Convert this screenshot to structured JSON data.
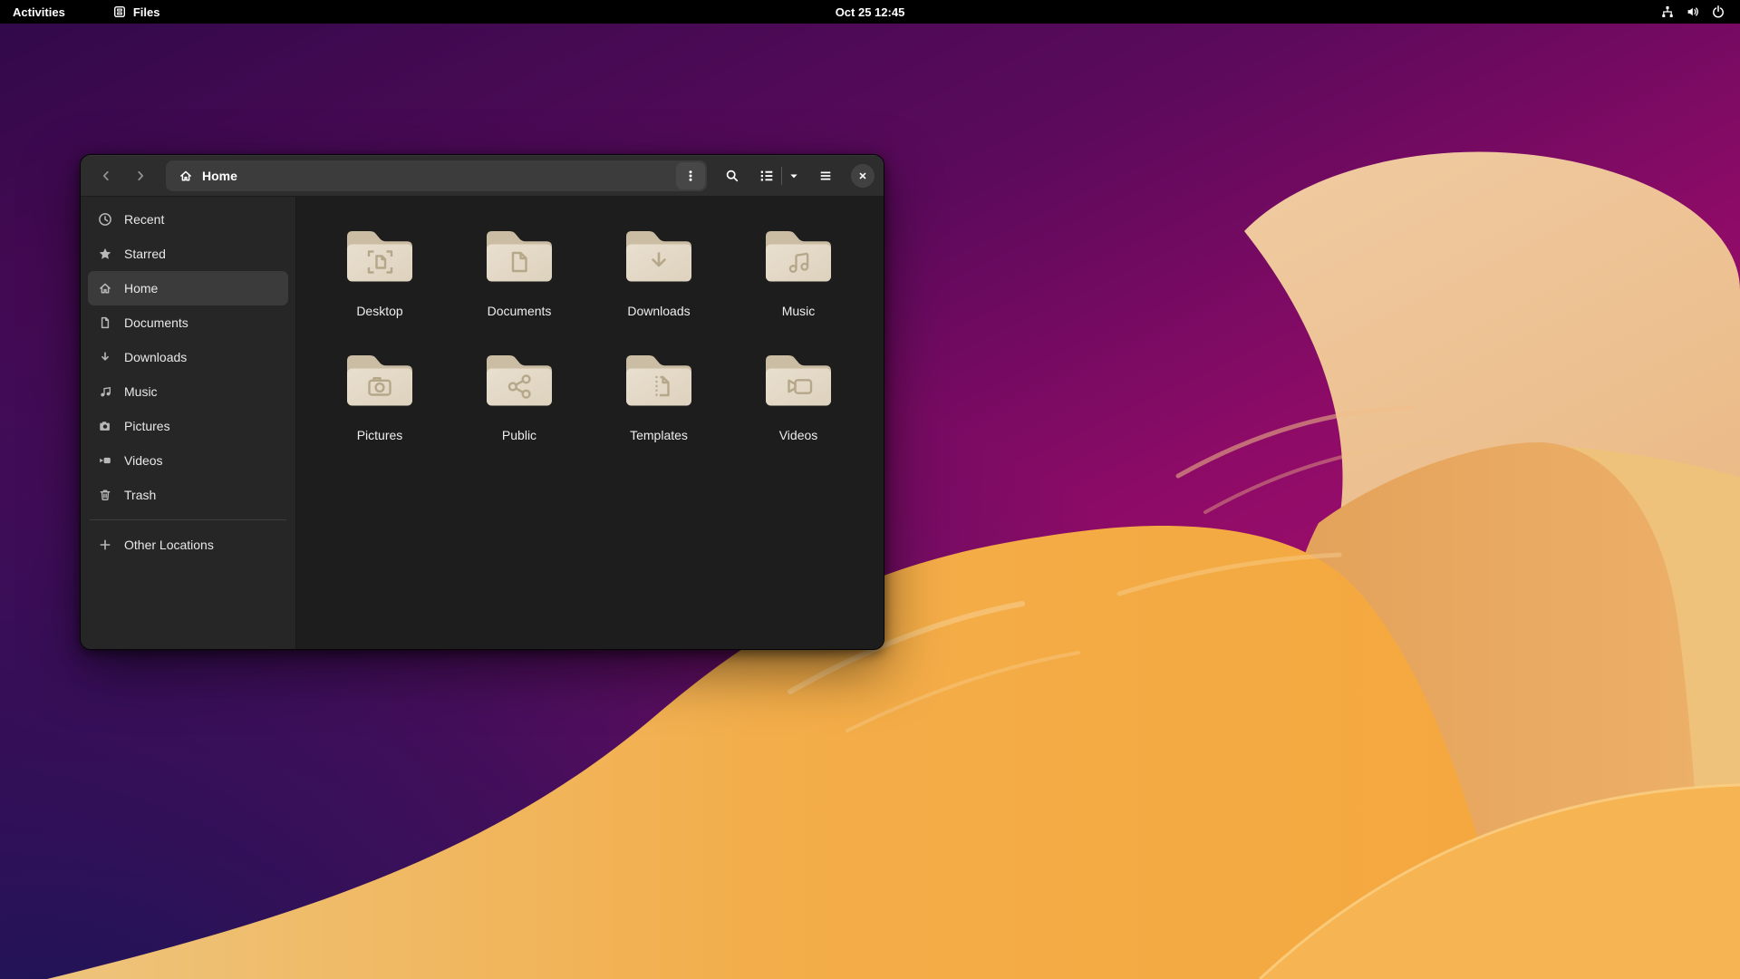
{
  "topbar": {
    "activities_label": "Activities",
    "app_indicator": {
      "label": "Files",
      "icon": "files-app-icon"
    },
    "clock": "Oct 25 12:45",
    "status_icons": [
      {
        "name": "network-icon"
      },
      {
        "name": "volume-icon"
      },
      {
        "name": "power-icon"
      }
    ]
  },
  "window": {
    "header": {
      "path": {
        "icon": "home-icon",
        "label": "Home",
        "menu_icon": "kebab-menu-icon"
      },
      "nav": {
        "back_icon": "chevron-left-icon",
        "forward_icon": "chevron-right-icon"
      },
      "search_icon": "search-icon",
      "view": {
        "toggle_icon": "list-view-icon",
        "dropdown_icon": "chevron-down-icon"
      },
      "menu_icon": "hamburger-menu-icon",
      "close_icon": "close-icon"
    },
    "sidebar": {
      "items": [
        {
          "label": "Recent",
          "icon": "recent",
          "selected": false
        },
        {
          "label": "Starred",
          "icon": "starred",
          "selected": false
        },
        {
          "label": "Home",
          "icon": "home",
          "selected": true
        },
        {
          "label": "Documents",
          "icon": "document",
          "selected": false
        },
        {
          "label": "Downloads",
          "icon": "download",
          "selected": false
        },
        {
          "label": "Music",
          "icon": "music",
          "selected": false
        },
        {
          "label": "Pictures",
          "icon": "camera",
          "selected": false
        },
        {
          "label": "Videos",
          "icon": "video",
          "selected": false
        },
        {
          "label": "Trash",
          "icon": "trash",
          "selected": false,
          "separator_after": true
        },
        {
          "label": "Other Locations",
          "icon": "plus",
          "selected": false
        }
      ]
    },
    "files": {
      "folders": [
        {
          "name": "Desktop",
          "emblem": "desktop"
        },
        {
          "name": "Documents",
          "emblem": "document"
        },
        {
          "name": "Downloads",
          "emblem": "download"
        },
        {
          "name": "Music",
          "emblem": "music"
        },
        {
          "name": "Pictures",
          "emblem": "camera"
        },
        {
          "name": "Public",
          "emblem": "share"
        },
        {
          "name": "Templates",
          "emblem": "template"
        },
        {
          "name": "Videos",
          "emblem": "video"
        }
      ]
    }
  },
  "colors": {
    "topbar_bg": "#000000",
    "header_bg": "#2d2d2d",
    "pathbar_bg": "#3c3c3c",
    "sidebar_bg": "#262626",
    "sidebar_selected_bg": "#3b3b3b",
    "content_bg": "#1d1d1d",
    "folder_front": "#e5dbc9",
    "folder_back": "#cbbda4",
    "folder_emblem": "#b5a78a",
    "wallpaper_palette": [
      "#30094a",
      "#8d0b67",
      "#a90e6f",
      "#1d1456",
      "#f0cba2",
      "#e2a058",
      "#f3ad49",
      "#f6b453"
    ]
  }
}
